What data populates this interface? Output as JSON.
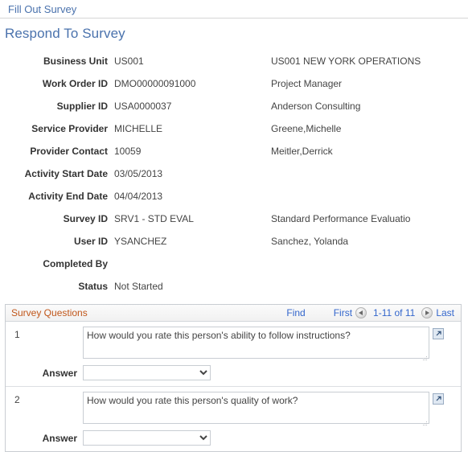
{
  "breadcrumb": {
    "label": "Fill Out Survey"
  },
  "page": {
    "title": "Respond To Survey"
  },
  "header_fields": [
    {
      "label": "Business Unit",
      "value": "US001",
      "value2": "US001 NEW YORK OPERATIONS"
    },
    {
      "label": "Work Order ID",
      "value": "DMO00000091000",
      "value2": "Project Manager"
    },
    {
      "label": "Supplier ID",
      "value": "USA0000037",
      "value2": "Anderson Consulting"
    },
    {
      "label": "Service Provider",
      "value": "MICHELLE",
      "value2": "Greene,Michelle"
    },
    {
      "label": "Provider Contact",
      "value": "10059",
      "value2": "Meitler,Derrick"
    },
    {
      "label": "Activity Start Date",
      "value": "03/05/2013",
      "value2": ""
    },
    {
      "label": "Activity End Date",
      "value": "04/04/2013",
      "value2": ""
    },
    {
      "label": "Survey ID",
      "value": "SRV1 - STD EVAL",
      "value2": "Standard Performance Evaluatio"
    },
    {
      "label": "User ID",
      "value": "YSANCHEZ",
      "value2": "Sanchez, Yolanda"
    },
    {
      "label": "Completed By",
      "value": "",
      "value2": ""
    },
    {
      "label": "Status",
      "value": "Not Started",
      "value2": ""
    }
  ],
  "grid": {
    "title": "Survey Questions",
    "find_label": "Find",
    "first_label": "First",
    "last_label": "Last",
    "range_label": "1-11 of 11",
    "prev_icon": "circle-left-arrow-icon",
    "next_icon": "circle-right-arrow-icon",
    "answer_label": "Answer",
    "expand_icon": "expand-text-icon",
    "rows": [
      {
        "number": "1",
        "question": "How would you rate this person's ability to follow instructions?",
        "answer": ""
      },
      {
        "number": "2",
        "question": "How would you rate this person's quality of work?",
        "answer": ""
      }
    ]
  },
  "colors": {
    "link": "#4a72ad",
    "title": "#4a72ad",
    "grid_title": "#c0561a",
    "grid_link": "#3366cc",
    "text": "#333333",
    "value_text": "#444444",
    "border": "#c9cdd2"
  }
}
